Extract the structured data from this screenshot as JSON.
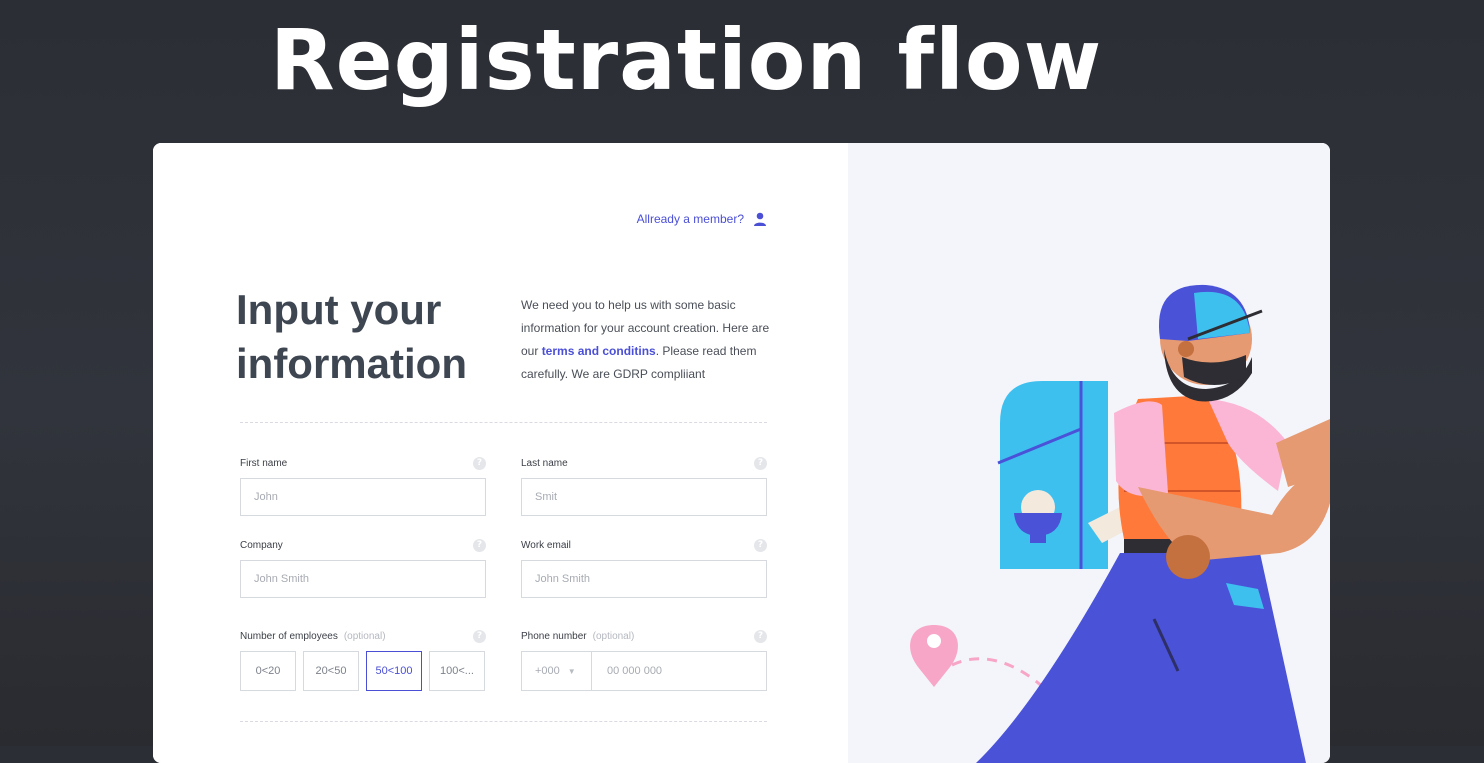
{
  "heading": "Registration flow",
  "header": {
    "member_link": "Allready a member?"
  },
  "title": {
    "line1": "Input your",
    "line2": "information"
  },
  "intro": {
    "before": "We need you to help us with some basic information for your account creation. Here are our ",
    "link": "terms and conditins",
    "after": ". Please read them carefully. We are GDRP compliiant"
  },
  "fields": {
    "first_name": {
      "label": "First name",
      "placeholder": "John"
    },
    "last_name": {
      "label": "Last name",
      "placeholder": "Smit"
    },
    "company": {
      "label": "Company",
      "placeholder": "John Smith"
    },
    "work_email": {
      "label": "Work email",
      "placeholder": "John Smith"
    },
    "employees": {
      "label": "Number of employees",
      "optional": "(optional)",
      "options": [
        "0<20",
        "20<50",
        "50<100",
        "100<..."
      ],
      "selected": "50<100"
    },
    "phone": {
      "label": "Phone number",
      "optional": "(optional)",
      "country_code": "+000",
      "placeholder": "00 000 000"
    }
  },
  "help_glyph": "?",
  "colors": {
    "accent": "#4b4fd6",
    "title": "#3e4652",
    "background": "#2e3038",
    "illustration_panel": "#f4f5fb"
  },
  "icons": [
    "user-icon",
    "help-icon",
    "chevron-down-icon"
  ]
}
